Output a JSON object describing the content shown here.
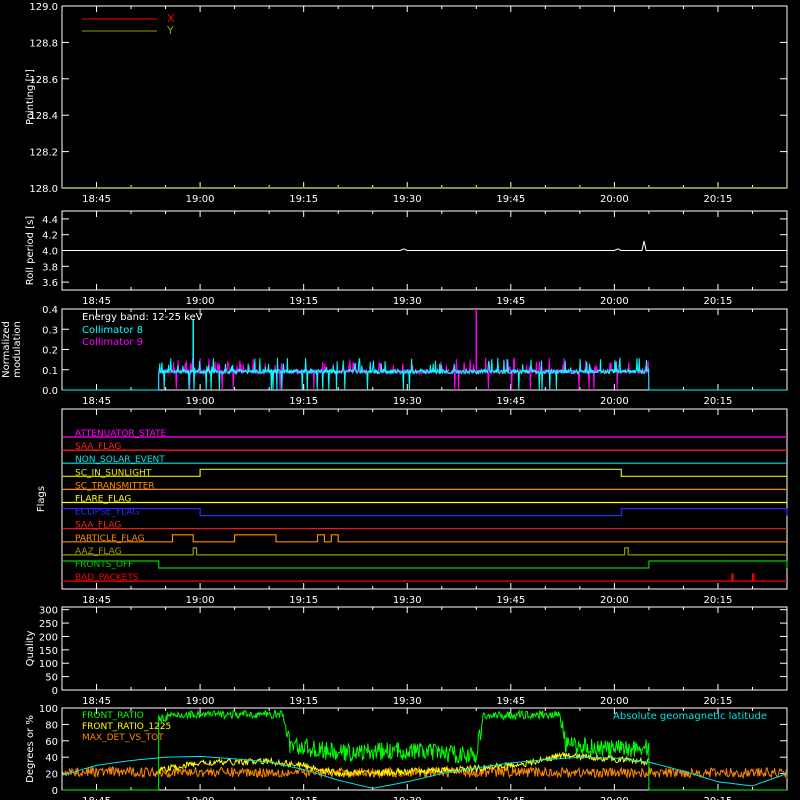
{
  "chart_data": [
    {
      "type": "line",
      "ylabel": "Pointing [\"]",
      "ylim": [
        128.0,
        129.0
      ],
      "yticks": [
        128.0,
        128.2,
        128.4,
        128.6,
        128.8,
        129.0
      ],
      "ytick_labels": [
        "128.0",
        "128.2",
        "128.4",
        "128.6",
        "128.8",
        "129.0"
      ],
      "xlim": [
        "18:40",
        "20:25"
      ],
      "xticks": [
        "18:45",
        "19:00",
        "19:15",
        "19:30",
        "19:45",
        "20:00",
        "20:15"
      ],
      "legend_position": "top-left",
      "series": [
        {
          "name": "X",
          "color": "#ff0000",
          "points": []
        },
        {
          "name": "Y",
          "color": "#9a9a00",
          "points": []
        }
      ]
    },
    {
      "type": "line",
      "ylabel": "Roll period [s]",
      "ylim": [
        3.5,
        4.5
      ],
      "yticks": [
        3.6,
        3.8,
        4.0,
        4.2,
        4.4
      ],
      "ytick_labels": [
        "3.6",
        "3.8",
        "4.0",
        "4.2",
        "4.4"
      ],
      "xlim": [
        "18:40",
        "20:25"
      ],
      "xticks": [
        "18:45",
        "19:00",
        "19:15",
        "19:30",
        "19:45",
        "20:00",
        "20:15"
      ],
      "series": [
        {
          "color": "#ffffff",
          "x": [
            "18:40",
            "19:29",
            "19:29.5",
            "19:30",
            "20:00",
            "20:00.5",
            "20:01",
            "20:04",
            "20:04.3",
            "20:04.6",
            "20:25"
          ],
          "y": [
            4.0,
            4.0,
            4.02,
            4.0,
            4.0,
            4.02,
            4.0,
            4.0,
            4.12,
            4.0,
            4.0
          ]
        }
      ]
    },
    {
      "type": "line",
      "ylabel": "Normalized modulation",
      "ylim": [
        0.0,
        0.4
      ],
      "yticks": [
        0.0,
        0.1,
        0.2,
        0.3,
        0.4
      ],
      "ytick_labels": [
        "0.0",
        "0.1",
        "0.2",
        "0.3",
        "0.4"
      ],
      "xlim": [
        "18:40",
        "20:25"
      ],
      "xticks": [
        "18:45",
        "19:00",
        "19:15",
        "19:30",
        "19:45",
        "20:00",
        "20:15"
      ],
      "annotation": "Energy band: 12-25 keV",
      "legend_position": "top-left",
      "active_range": [
        "18:54",
        "20:05"
      ],
      "baseline": 0.09,
      "spikes": [
        {
          "x": "18:59",
          "y": 0.35
        },
        {
          "x": "19:40",
          "y": 0.4
        }
      ],
      "series": [
        {
          "name": "Collimator 8",
          "color": "#00ffff"
        },
        {
          "name": "Collimator 9",
          "color": "#ff00ff"
        }
      ]
    },
    {
      "type": "timeline",
      "ylabel": "Flags",
      "xlim": [
        "18:40",
        "20:25"
      ],
      "xticks": [
        "18:45",
        "19:00",
        "19:15",
        "19:30",
        "19:45",
        "20:00",
        "20:15"
      ],
      "flags": [
        {
          "name": "ATTENUATOR_STATE",
          "color": "#ff00ff",
          "high": []
        },
        {
          "name": "SAA_FLAG",
          "color": "#ff2020",
          "high": []
        },
        {
          "name": "NON_SOLAR_EVENT",
          "color": "#00e5e5",
          "high": []
        },
        {
          "name": "SC_IN_SUNLIGHT",
          "color": "#e6e600",
          "high": [
            [
              "19:00",
              "20:01"
            ]
          ]
        },
        {
          "name": "SC_TRANSMITTER",
          "color": "#ff8c00",
          "high": []
        },
        {
          "name": "FLARE_FLAG",
          "color": "#ffff00",
          "high": []
        },
        {
          "name": "ECLIPSE_FLAG",
          "color": "#2a2aff",
          "high": [
            [
              "18:40",
              "19:00"
            ],
            [
              "20:01",
              "20:25"
            ]
          ]
        },
        {
          "name": "SAA_FLAG",
          "color": "#ff2020",
          "high": []
        },
        {
          "name": "PARTICLE_FLAG",
          "color": "#ff8c00",
          "high": [
            [
              "18:56",
              "18:59"
            ],
            [
              "19:05",
              "19:11"
            ],
            [
              "19:17",
              "19:18"
            ],
            [
              "19:19",
              "19:20"
            ]
          ]
        },
        {
          "name": "AAZ_FLAG",
          "color": "#9a9a00",
          "high": [
            [
              "18:59",
              "18:59.5"
            ],
            [
              "20:01.5",
              "20:02"
            ]
          ]
        },
        {
          "name": "FRONTS_OFF",
          "color": "#00cc00",
          "high": [
            [
              "18:40",
              "18:54"
            ],
            [
              "20:05",
              "20:25"
            ]
          ]
        },
        {
          "name": "BAD_PACKETS",
          "color": "#ff0000",
          "high": [
            [
              "20:17",
              "20:17.2"
            ],
            [
              "20:20",
              "20:20.2"
            ]
          ]
        }
      ]
    },
    {
      "type": "line",
      "ylabel": "Quality",
      "ylim": [
        0,
        310
      ],
      "yticks": [
        0,
        50,
        100,
        150,
        200,
        250,
        300
      ],
      "ytick_labels": [
        "0",
        "50",
        "100",
        "150",
        "200",
        "250",
        "300"
      ],
      "xlim": [
        "18:40",
        "20:25"
      ],
      "xticks": [
        "18:45",
        "19:00",
        "19:15",
        "19:30",
        "19:45",
        "20:00",
        "20:15"
      ],
      "series": []
    },
    {
      "type": "line",
      "ylabel": "Degrees or %",
      "ylim": [
        0,
        100
      ],
      "yticks": [
        0,
        20,
        40,
        60,
        80,
        100
      ],
      "ytick_labels": [
        "0",
        "20",
        "40",
        "60",
        "80",
        "100"
      ],
      "xlim": [
        "18:40",
        "20:25"
      ],
      "xticks": [
        "18:45",
        "19:00",
        "19:15",
        "19:30",
        "19:45",
        "20:00",
        "20:15"
      ],
      "legend_position": "top-left",
      "right_label": "Absolute geomagnetic latitude",
      "right_label_color": "#00e5e5",
      "series": [
        {
          "name": "FRONT_RATIO",
          "color": "#00ff00",
          "x": [
            "18:54",
            "18:58",
            "19:05",
            "19:12",
            "19:13",
            "19:20",
            "19:30",
            "19:40",
            "19:41",
            "19:48",
            "19:52",
            "19:53",
            "20:00",
            "20:05"
          ],
          "y": [
            88,
            92,
            92,
            92,
            55,
            45,
            48,
            42,
            90,
            92,
            92,
            55,
            50,
            52
          ]
        },
        {
          "name": "FRONT_RATIO_1225",
          "color": "#ffff00",
          "x": [
            "18:54",
            "19:00",
            "19:10",
            "19:15",
            "19:20",
            "19:30",
            "19:40",
            "19:48",
            "19:52",
            "19:57",
            "20:05"
          ],
          "y": [
            24,
            33,
            35,
            30,
            20,
            22,
            26,
            33,
            42,
            40,
            34
          ]
        },
        {
          "name": "MAX_DET_VS_TOT",
          "color": "#ff8800",
          "x": [
            "18:40",
            "19:00",
            "19:20",
            "19:40",
            "20:00",
            "20:25"
          ],
          "y": [
            22,
            22,
            21,
            22,
            21,
            21
          ]
        },
        {
          "color": "#00e5e5",
          "x": [
            "18:40",
            "18:45",
            "18:50",
            "18:55",
            "19:00",
            "19:05",
            "19:10",
            "19:15",
            "19:20",
            "19:25",
            "19:30",
            "19:35",
            "19:40",
            "19:45",
            "19:50",
            "19:55",
            "20:00",
            "20:05",
            "20:10",
            "20:15",
            "20:20",
            "20:25"
          ],
          "y": [
            18,
            30,
            36,
            40,
            41,
            38,
            34,
            25,
            12,
            2,
            10,
            20,
            27,
            33,
            37,
            40,
            39,
            34,
            23,
            10,
            5,
            20
          ]
        }
      ]
    }
  ]
}
